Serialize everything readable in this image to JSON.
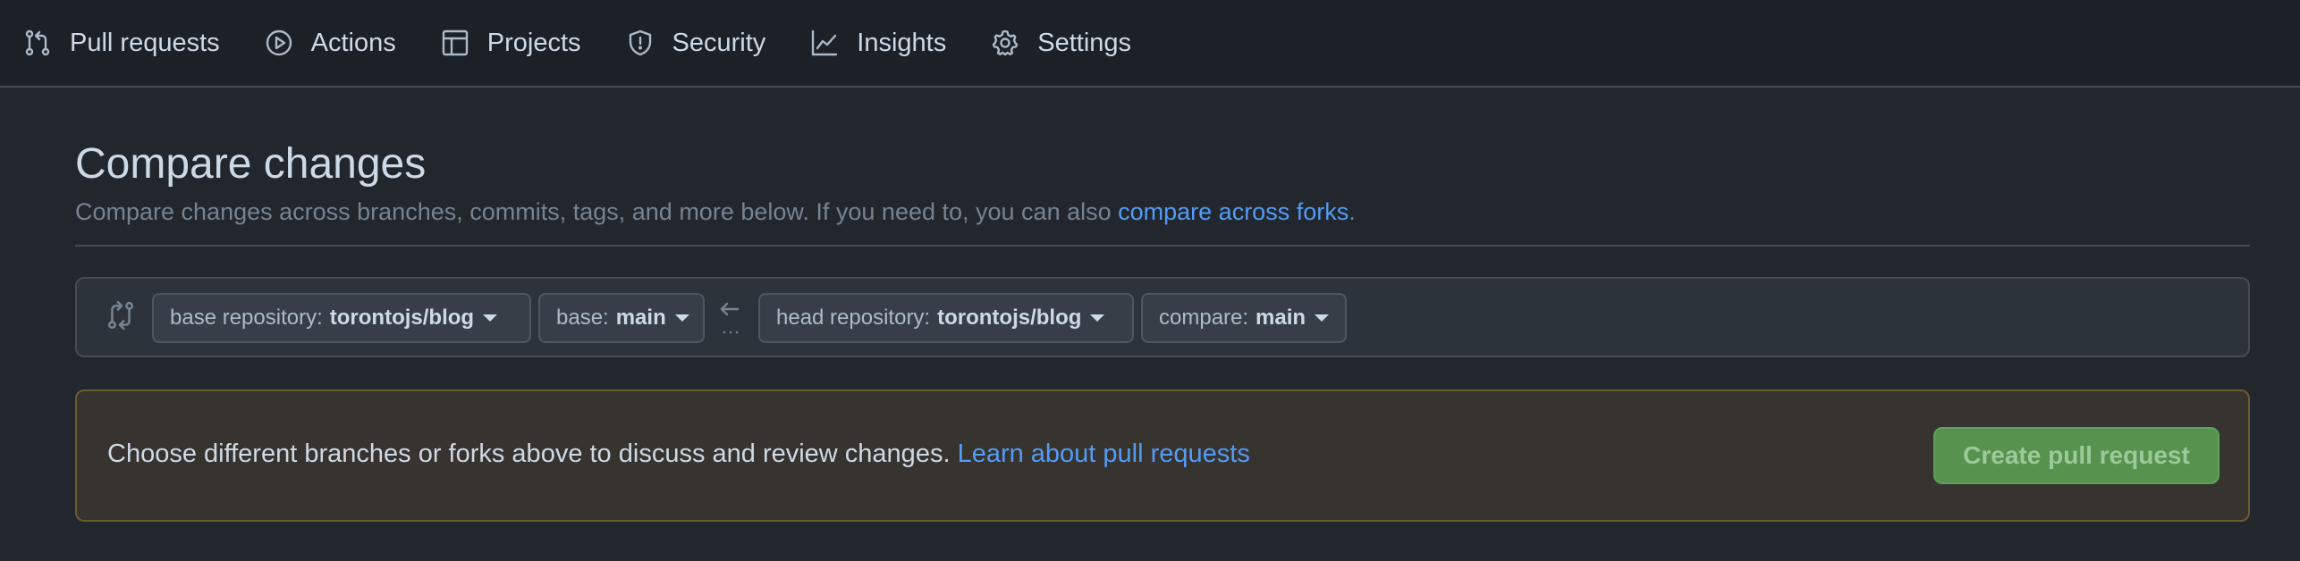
{
  "nav": {
    "items": [
      {
        "label": "Pull requests",
        "icon": "git-pull-request-icon"
      },
      {
        "label": "Actions",
        "icon": "play-icon"
      },
      {
        "label": "Projects",
        "icon": "table-icon"
      },
      {
        "label": "Security",
        "icon": "shield-icon"
      },
      {
        "label": "Insights",
        "icon": "graph-icon"
      },
      {
        "label": "Settings",
        "icon": "gear-icon"
      }
    ]
  },
  "compare": {
    "title": "Compare changes",
    "subtitle_prefix": "Compare changes across branches, commits, tags, and more below. If you need to, you can also ",
    "subtitle_link": "compare across forks",
    "subtitle_suffix": ".",
    "base_repo_label": "base repository:",
    "base_repo_value": "torontojs/blog",
    "base_label": "base:",
    "base_value": "main",
    "head_repo_label": "head repository:",
    "head_repo_value": "torontojs/blog",
    "compare_label": "compare:",
    "compare_value": "main"
  },
  "flash": {
    "message": "Choose different branches or forks above to discuss and review changes. ",
    "link": "Learn about pull requests",
    "button": "Create pull request"
  },
  "colors": {
    "background": "#22272e",
    "nav_background": "#1c2128",
    "link": "#539bf5",
    "create_button": "#57934f",
    "flash_background": "#37332f"
  }
}
